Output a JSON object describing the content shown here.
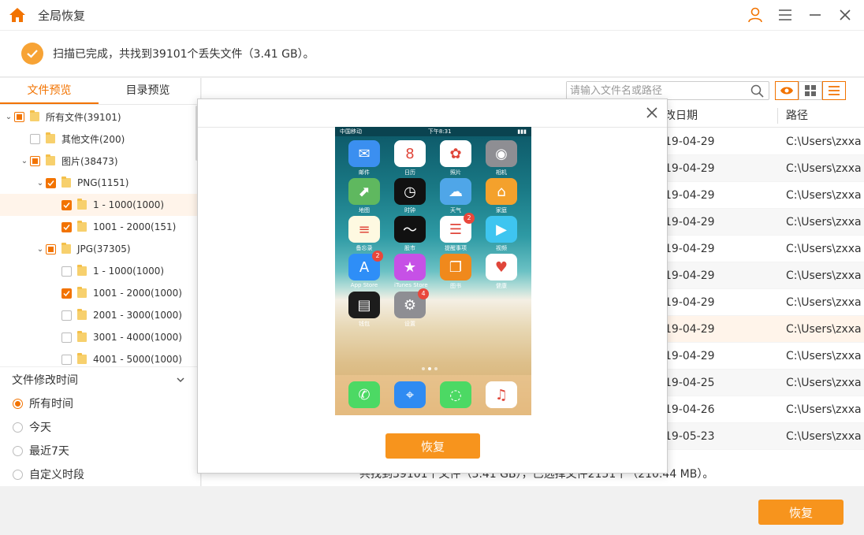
{
  "window": {
    "title": "全局恢复",
    "icons": {
      "home": "home-icon",
      "user": "user-icon",
      "menu": "menu-icon",
      "minimize": "minimize-icon",
      "close": "close-icon"
    }
  },
  "status": {
    "text": "扫描已完成，共找到39101个丢失文件（3.41 GB）。"
  },
  "left": {
    "tabs": [
      {
        "label": "文件预览",
        "active": true
      },
      {
        "label": "目录预览",
        "active": false
      }
    ],
    "tree": [
      {
        "label": "所有文件(39101)",
        "check": "partial",
        "caret": "down",
        "level": 0
      },
      {
        "label": "其他文件(200)",
        "check": "none",
        "caret": "",
        "level": 1
      },
      {
        "label": "图片(38473)",
        "check": "partial",
        "caret": "down",
        "level": 1
      },
      {
        "label": "PNG(1151)",
        "check": "checked",
        "caret": "down",
        "level": 2
      },
      {
        "label": "1 - 1000(1000)",
        "check": "checked",
        "caret": "",
        "level": 3,
        "highlight": true
      },
      {
        "label": "1001 - 2000(151)",
        "check": "checked",
        "caret": "",
        "level": 3
      },
      {
        "label": "JPG(37305)",
        "check": "partial",
        "caret": "down",
        "level": 2
      },
      {
        "label": "1 - 1000(1000)",
        "check": "none",
        "caret": "",
        "level": 3
      },
      {
        "label": "1001 - 2000(1000)",
        "check": "checked",
        "caret": "",
        "level": 3
      },
      {
        "label": "2001 - 3000(1000)",
        "check": "none",
        "caret": "",
        "level": 3
      },
      {
        "label": "3001 - 4000(1000)",
        "check": "none",
        "caret": "",
        "level": 3
      },
      {
        "label": "4001 - 5000(1000)",
        "check": "none",
        "caret": "",
        "level": 3
      }
    ],
    "filter": {
      "title": "文件修改时间",
      "options": [
        {
          "label": "所有时间",
          "selected": true
        },
        {
          "label": "今天",
          "selected": false
        },
        {
          "label": "最近7天",
          "selected": false
        },
        {
          "label": "自定义时段",
          "selected": false
        }
      ]
    }
  },
  "right": {
    "search_placeholder": "请输入文件名或路径",
    "columns": {
      "date_partial": "改日期",
      "path": "路径"
    },
    "rows": [
      {
        "date": "19-04-29",
        "path": "C:\\Users\\zxxa..."
      },
      {
        "date": "19-04-29",
        "path": "C:\\Users\\zxxa..."
      },
      {
        "date": "19-04-29",
        "path": "C:\\Users\\zxxa..."
      },
      {
        "date": "19-04-29",
        "path": "C:\\Users\\zxxa..."
      },
      {
        "date": "19-04-29",
        "path": "C:\\Users\\zxxa..."
      },
      {
        "date": "19-04-29",
        "path": "C:\\Users\\zxxa..."
      },
      {
        "date": "19-04-29",
        "path": "C:\\Users\\zxxa..."
      },
      {
        "date": "19-04-29",
        "path": "C:\\Users\\zxxa...",
        "highlight": true
      },
      {
        "date": "19-04-29",
        "path": "C:\\Users\\zxxa..."
      },
      {
        "date": "19-04-25",
        "path": "C:\\Users\\zxxa..."
      },
      {
        "date": "19-04-26",
        "path": "C:\\Users\\zxxa..."
      },
      {
        "date": "19-05-23",
        "path": "C:\\Users\\zxxa..."
      }
    ],
    "summary": "共找到39101个文件（3.41 GB），已选择文件2151个（210.44 MB）。"
  },
  "dialog": {
    "recover_label": "恢复"
  },
  "phone": {
    "status_left": "中国移动",
    "status_center": "下午8:31",
    "apps": [
      {
        "label": "邮件",
        "color": "#3b8ff0",
        "glyph": "✉"
      },
      {
        "label": "日历",
        "color": "#ffffff",
        "glyph": "8"
      },
      {
        "label": "照片",
        "color": "#ffffff",
        "glyph": "✿"
      },
      {
        "label": "相机",
        "color": "#8e8e93",
        "glyph": "◉"
      },
      {
        "label": "地图",
        "color": "#5fb85f",
        "glyph": "⬈"
      },
      {
        "label": "时钟",
        "color": "#111111",
        "glyph": "◷"
      },
      {
        "label": "天气",
        "color": "#4fa6e8",
        "glyph": "☁"
      },
      {
        "label": "家庭",
        "color": "#f4a12c",
        "glyph": "⌂"
      },
      {
        "label": "备忘录",
        "color": "#fef9e1",
        "glyph": "≡"
      },
      {
        "label": "股市",
        "color": "#111111",
        "glyph": "〜"
      },
      {
        "label": "提醒事项",
        "color": "#ffffff",
        "glyph": "☰",
        "badge": "2"
      },
      {
        "label": "视频",
        "color": "#3ec5f0",
        "glyph": "▶"
      },
      {
        "label": "App Store",
        "color": "#2e8ef7",
        "glyph": "A",
        "badge": "2"
      },
      {
        "label": "iTunes Store",
        "color": "#c651e6",
        "glyph": "★"
      },
      {
        "label": "图书",
        "color": "#f0891c",
        "glyph": "❐"
      },
      {
        "label": "健康",
        "color": "#ffffff",
        "glyph": "♥"
      },
      {
        "label": "钱包",
        "color": "#1c1c1c",
        "glyph": "▤"
      },
      {
        "label": "设置",
        "color": "#8e8e93",
        "glyph": "⚙",
        "badge": "4"
      }
    ],
    "dock": [
      {
        "name": "phone-app",
        "color": "#4cd964",
        "glyph": "✆"
      },
      {
        "name": "safari-app",
        "color": "#2f8bf2",
        "glyph": "⌖"
      },
      {
        "name": "messages-app",
        "color": "#4cd964",
        "glyph": "◌"
      },
      {
        "name": "music-app",
        "color": "#ffffff",
        "glyph": "♫"
      }
    ]
  },
  "bottom": {
    "recover_label": "恢复"
  },
  "colors": {
    "accent": "#f27300",
    "button": "#f7941d"
  }
}
